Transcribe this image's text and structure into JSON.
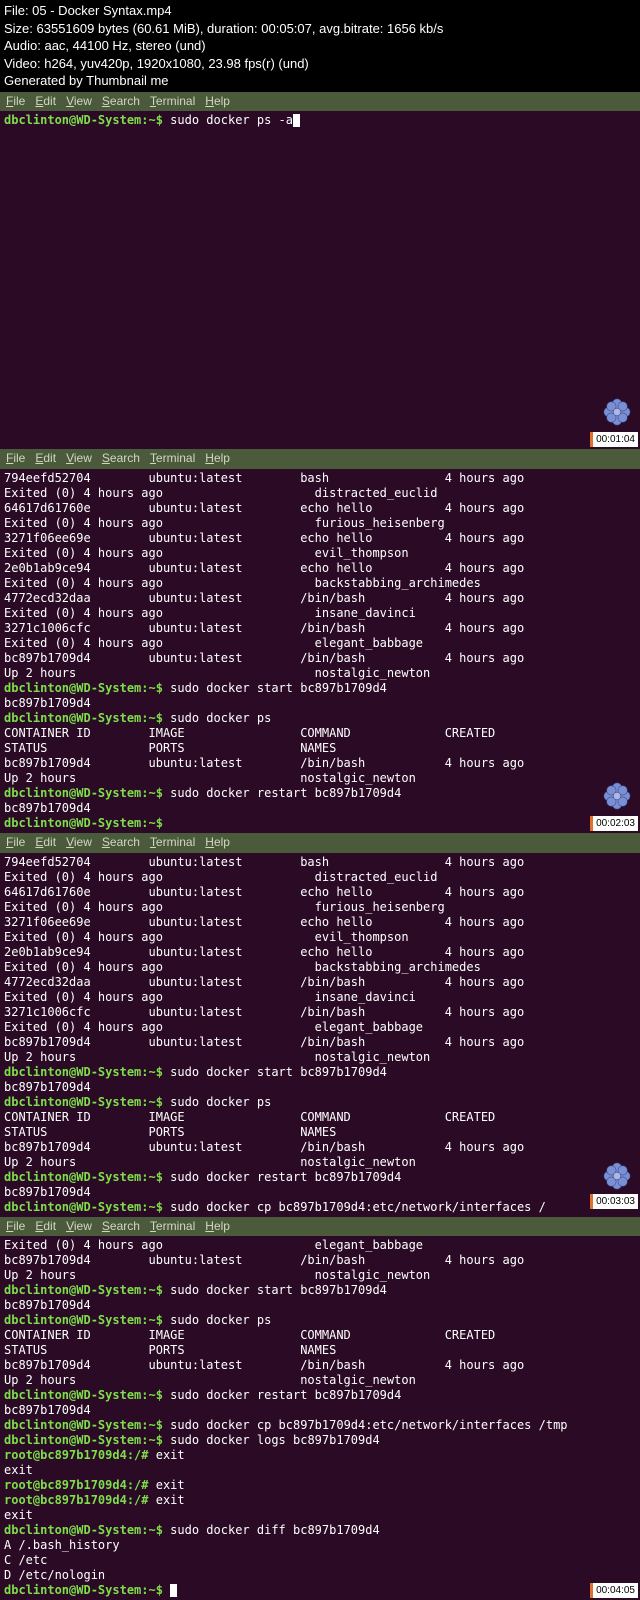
{
  "header": {
    "file": "File: 05 - Docker Syntax.mp4",
    "size": "Size: 63551609 bytes (60.61 MiB), duration: 00:05:07, avg.bitrate: 1656 kb/s",
    "audio": "Audio: aac, 44100 Hz, stereo (und)",
    "video": "Video: h264, yuv420p, 1920x1080, 23.98 fps(r) (und)",
    "gen": "Generated by Thumbnail me"
  },
  "menu": {
    "file": "File",
    "edit": "Edit",
    "view": "View",
    "search": "Search",
    "terminal": "Terminal",
    "help": "Help"
  },
  "timestamps": {
    "f1": "00:01:04",
    "f2": "00:02:03",
    "f3": "00:03:03",
    "f4": "00:04:05"
  },
  "frame1": {
    "prompt": "dbclinton@WD-System:~$ ",
    "cmd": "sudo docker ps -a"
  },
  "docker_block": "794eefd52704        ubuntu:latest        bash                4 hours ago\nExited (0) 4 hours ago                     distracted_euclid\n64617d61760e        ubuntu:latest        echo hello          4 hours ago\nExited (0) 4 hours ago                     furious_heisenberg\n3271f06ee69e        ubuntu:latest        echo hello          4 hours ago\nExited (0) 4 hours ago                     evil_thompson\n2e0b1ab9ce94        ubuntu:latest        echo hello          4 hours ago\nExited (0) 4 hours ago                     backstabbing_archimedes\n4772ecd32daa        ubuntu:latest        /bin/bash           4 hours ago\nExited (0) 4 hours ago                     insane_davinci\n3271c1006cfc        ubuntu:latest        /bin/bash           4 hours ago\nExited (0) 4 hours ago                     elegant_babbage\nbc897b1709d4        ubuntu:latest        /bin/bash           4 hours ago\nUp 2 hours                                 nostalgic_newton",
  "f2_tail": {
    "p1": "dbclinton@WD-System:~$ ",
    "c1": "sudo docker start bc897b1709d4",
    "o1": "bc897b1709d4",
    "p2": "dbclinton@WD-System:~$ ",
    "c2": "sudo docker ps",
    "o2": "CONTAINER ID        IMAGE                COMMAND             CREATED\nSTATUS              PORTS                NAMES\nbc897b1709d4        ubuntu:latest        /bin/bash           4 hours ago\nUp 2 hours                               nostalgic_newton",
    "p3": "dbclinton@WD-System:~$ ",
    "c3": "sudo docker restart bc897b1709d4",
    "o3": "bc897b1709d4",
    "p4": "dbclinton@WD-System:~$ "
  },
  "f3_tail": {
    "p5": "dbclinton@WD-System:~$ ",
    "c5": "sudo docker cp bc897b1709d4:etc/network/interfaces /"
  },
  "f4": {
    "l1": "Exited (0) 4 hours ago                     elegant_babbage",
    "l2": "bc897b1709d4        ubuntu:latest        /bin/bash           4 hours ago",
    "l3": "Up 2 hours                                 nostalgic_newton",
    "p1": "dbclinton@WD-System:~$ ",
    "c1": "sudo docker start bc897b1709d4",
    "o1": "bc897b1709d4",
    "p2": "dbclinton@WD-System:~$ ",
    "c2": "sudo docker ps",
    "o2": "CONTAINER ID        IMAGE                COMMAND             CREATED\nSTATUS              PORTS                NAMES\nbc897b1709d4        ubuntu:latest        /bin/bash           4 hours ago\nUp 2 hours                               nostalgic_newton",
    "p3": "dbclinton@WD-System:~$ ",
    "c3": "sudo docker restart bc897b1709d4",
    "o3": "bc897b1709d4",
    "p4": "dbclinton@WD-System:~$ ",
    "c4": "sudo docker cp bc897b1709d4:etc/network/interfaces /tmp",
    "p5": "dbclinton@WD-System:~$ ",
    "c5": "sudo docker logs bc897b1709d4",
    "rp": "root@bc897b1709d4:/# ",
    "ex": "exit",
    "exo": "exit",
    "p6": "dbclinton@WD-System:~$ ",
    "c6": "sudo docker diff bc897b1709d4",
    "diff": "A /.bash_history\nC /etc\nD /etc/nologin",
    "p7": "dbclinton@WD-System:~$ "
  }
}
